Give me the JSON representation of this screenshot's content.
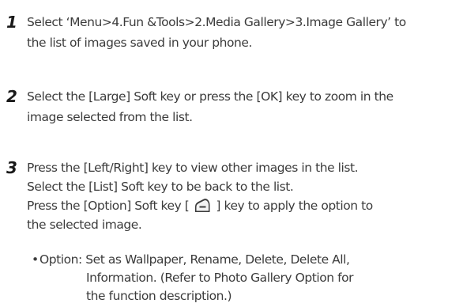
{
  "steps": [
    {
      "number": "1",
      "lines": [
        "Select ‘Menu>4.Fun &Tools>2.Media Gallery>3.Image Gallery’ to",
        "the list of images saved in your phone."
      ]
    },
    {
      "number": "2",
      "lines": [
        "Select the [Large] Soft key or press the [OK] key to zoom in the",
        "image selected from the list."
      ]
    },
    {
      "number": "3",
      "lines": [
        "Press the [Left/Right] key to view other images in the list.",
        "Select the [List] Soft key to be back to the list.",
        "Press the [Option] Soft key [",
        "] key to apply the option to",
        "the selected image."
      ]
    }
  ],
  "option": {
    "bullet": "•",
    "lines": [
      "Option: Set as Wallpaper, Rename, Delete, Delete All,",
      "Information. (Refer to Photo Gallery Option for",
      "the function description.)"
    ]
  },
  "icons": {
    "option_softkey": "option-softkey-icon"
  }
}
